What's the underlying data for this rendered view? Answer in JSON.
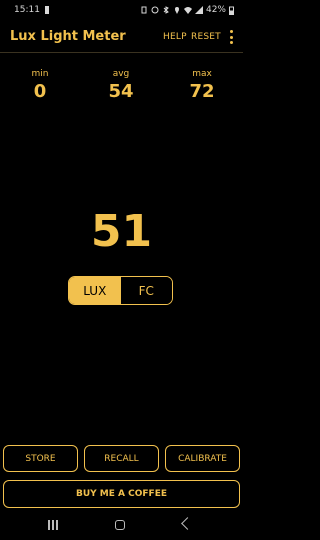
{
  "status": {
    "time": "15:11",
    "battery": "42%"
  },
  "toolbar": {
    "title": "Lux Light Meter",
    "help": "HELP",
    "reset": "RESET"
  },
  "stats": {
    "min_label": "min",
    "min_value": "0",
    "avg_label": "avg",
    "avg_value": "54",
    "max_label": "max",
    "max_value": "72"
  },
  "reading": {
    "value": "51"
  },
  "units": {
    "lux": "LUX",
    "fc": "FC",
    "selected": "LUX"
  },
  "actions": {
    "store": "STORE",
    "recall": "RECALL",
    "calibrate": "CALIBRATE",
    "coffee": "BUY ME A COFFEE"
  },
  "colors": {
    "accent": "#f2c14e",
    "background": "#000000"
  }
}
